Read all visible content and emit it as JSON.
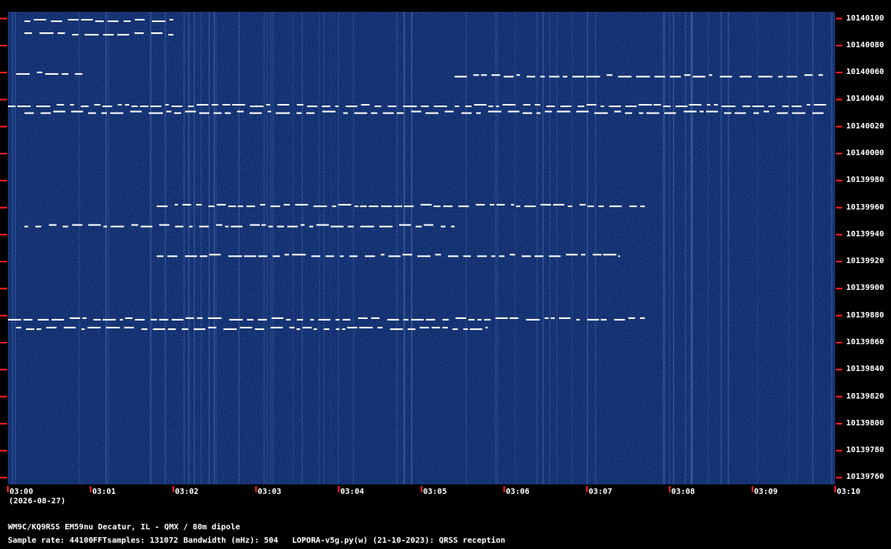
{
  "chart_data": {
    "type": "heatmap",
    "title": "",
    "x_ticks": [
      "03:00",
      "03:01",
      "03:02",
      "03:03",
      "03:04",
      "03:05",
      "03:06",
      "03:07",
      "03:08",
      "03:09",
      "03:10"
    ],
    "date_label": "(2026-08-27)",
    "y_ticks": [
      "10140100",
      "10140080",
      "10140060",
      "10140040",
      "10140020",
      "10140000",
      "10139980",
      "10139960",
      "10139940",
      "10139920",
      "10139900",
      "10139880",
      "10139860",
      "10139840",
      "10139820",
      "10139800",
      "10139780",
      "10139760"
    ],
    "x_range": [
      "03:00",
      "03:10"
    ],
    "y_range": [
      10139755,
      10140105
    ],
    "colors": {
      "background": "#0d2a6b",
      "signal": "#ffffff",
      "tick": "#ff2020",
      "frame": "#000000"
    },
    "traces": [
      {
        "freq": 10140098,
        "start": "03:00.2",
        "end": "03:02.0"
      },
      {
        "freq": 10140088,
        "start": "03:00.2",
        "end": "03:02.0"
      },
      {
        "freq": 10140059,
        "start": "03:00.1",
        "end": "03:00.9"
      },
      {
        "freq": 10140057,
        "start": "03:05.4",
        "end": "03:09.9"
      },
      {
        "freq": 10140035,
        "start": "03:00.0",
        "end": "03:09.9"
      },
      {
        "freq": 10140030,
        "start": "03:00.2",
        "end": "03:09.9"
      },
      {
        "freq": 10139961,
        "start": "03:01.8",
        "end": "03:07.7"
      },
      {
        "freq": 10139946,
        "start": "03:00.2",
        "end": "03:05.4"
      },
      {
        "freq": 10139924,
        "start": "03:01.8",
        "end": "03:07.4"
      },
      {
        "freq": 10139877,
        "start": "03:00.0",
        "end": "03:07.7"
      },
      {
        "freq": 10139870,
        "start": "03:00.1",
        "end": "03:05.8"
      }
    ]
  },
  "footer": {
    "station": "WM9C/KQ9RSS EM59nu Decatur, IL - QMX / 80m dipole",
    "sample_rate": "Sample rate: 44100",
    "fft_samples": "FFTsamples: 131072",
    "bandwidth": "Bandwidth (mHz): 504",
    "software": "LOPORA-v5g.py(w) (21-10-2023): QRSS reception"
  }
}
